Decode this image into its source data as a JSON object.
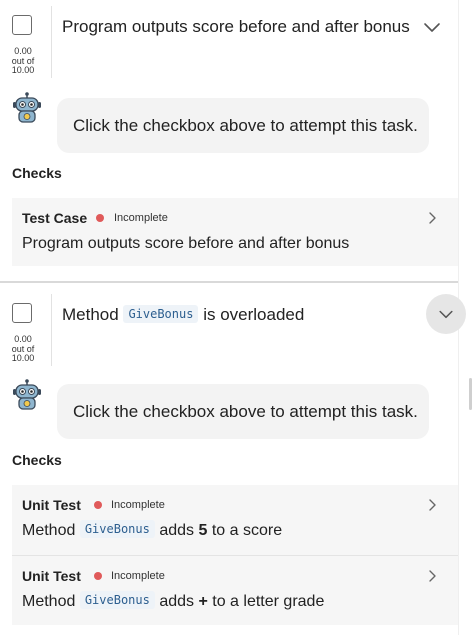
{
  "tasks": [
    {
      "score": {
        "value": "0.00",
        "out_of": "out of",
        "max": "10.00"
      },
      "title_prefix": "Program outputs score before and after bonus",
      "title_code": "",
      "title_suffix": "",
      "assistant_message": "Click the checkbox above to attempt this task.",
      "checks_label": "Checks",
      "checks": [
        {
          "type": "Test Case",
          "status": "Incomplete",
          "desc_prefix": "Program outputs score before and after bonus",
          "desc_code": "",
          "desc_mid": "",
          "desc_bold": "",
          "desc_suffix": ""
        }
      ]
    },
    {
      "score": {
        "value": "0.00",
        "out_of": "out of",
        "max": "10.00"
      },
      "title_prefix": "Method",
      "title_code": "GiveBonus",
      "title_suffix": "is overloaded",
      "assistant_message": "Click the checkbox above to attempt this task.",
      "checks_label": "Checks",
      "checks": [
        {
          "type": "Unit Test",
          "status": "Incomplete",
          "desc_prefix": "Method",
          "desc_code": "GiveBonus",
          "desc_mid": "adds",
          "desc_bold": "5",
          "desc_suffix": "to a score"
        },
        {
          "type": "Unit Test",
          "status": "Incomplete",
          "desc_prefix": "Method",
          "desc_code": "GiveBonus",
          "desc_mid": "adds",
          "desc_bold": "+",
          "desc_suffix": "to a letter grade"
        }
      ]
    }
  ],
  "colors": {
    "status_incomplete": "#e05a5a",
    "code_text": "#2c5e8f",
    "bubble_bg": "#f3f3f3",
    "card_bg": "#f6f6f6"
  },
  "icons": {
    "expand": "chevron-down-icon",
    "open_check": "chevron-right-icon",
    "assistant": "robot-avatar-icon"
  }
}
